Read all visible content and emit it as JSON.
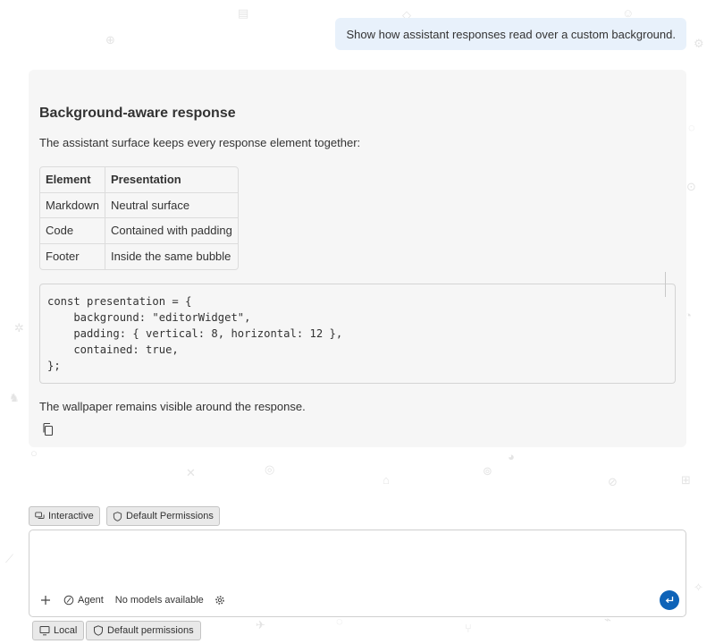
{
  "user_message": "Show how assistant responses read over a custom background.",
  "response": {
    "title": "Background-aware response",
    "intro": "The assistant surface keeps every response element together:",
    "table": {
      "headers": [
        "Element",
        "Presentation"
      ],
      "rows": [
        [
          "Markdown",
          "Neutral surface"
        ],
        [
          "Code",
          "Contained with padding"
        ],
        [
          "Footer",
          "Inside the same bubble"
        ]
      ]
    },
    "code_lines": [
      "const presentation = {",
      "    background: \"editorWidget\",",
      "    padding: { vertical: 8, horizontal: 12 },",
      "    contained: true,",
      "};"
    ],
    "outro": "The wallpaper remains visible around the response."
  },
  "input_chips": {
    "mode": "Interactive",
    "permissions": "Default Permissions"
  },
  "composer": {
    "agent_label": "Agent",
    "model_label": "No models available"
  },
  "bottom_chips": {
    "local": "Local",
    "permissions": "Default permissions"
  },
  "colors": {
    "user_bubble": "#e8f1fb",
    "assistant_surface": "#f6f6f6",
    "send_button": "#0e63b8"
  }
}
